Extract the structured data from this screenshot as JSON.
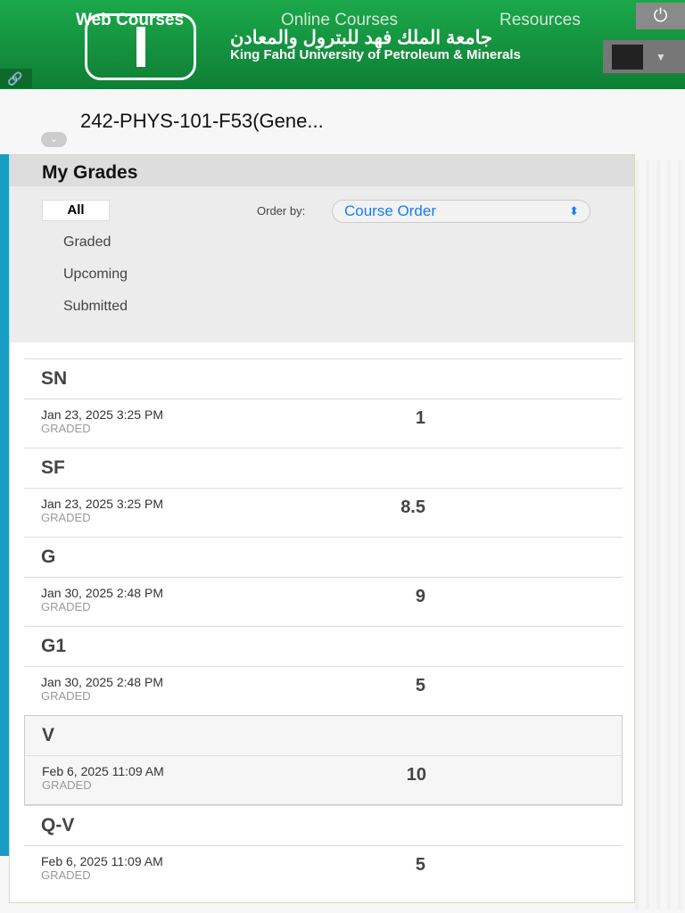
{
  "header": {
    "nav": [
      "Web Courses",
      "Online Courses",
      "Resources"
    ],
    "arabic_name": "جامعة الملك فهد للبترول والمعادن",
    "university": "King Fahd University of Petroleum & Minerals"
  },
  "course_title": "242-PHYS-101-F53(Gene...",
  "panel": {
    "title": "My Grades",
    "filters": [
      "All",
      "Graded",
      "Upcoming",
      "Submitted"
    ],
    "order_label": "Order by:",
    "order_value": "Course Order"
  },
  "items": [
    {
      "name": "SN",
      "date": "Jan 23, 2025 3:25 PM",
      "status": "GRADED",
      "grade": "1"
    },
    {
      "name": "SF",
      "date": "Jan 23, 2025 3:25 PM",
      "status": "GRADED",
      "grade": "8.5"
    },
    {
      "name": "G",
      "date": "Jan 30, 2025 2:48 PM",
      "status": "GRADED",
      "grade": "9"
    },
    {
      "name": "G1",
      "date": "Jan 30, 2025 2:48 PM",
      "status": "GRADED",
      "grade": "5"
    },
    {
      "name": "V",
      "date": "Feb 6, 2025 11:09 AM",
      "status": "GRADED",
      "grade": "10"
    },
    {
      "name": "Q-V",
      "date": "Feb 6, 2025 11:09 AM",
      "status": "GRADED",
      "grade": "5"
    }
  ]
}
